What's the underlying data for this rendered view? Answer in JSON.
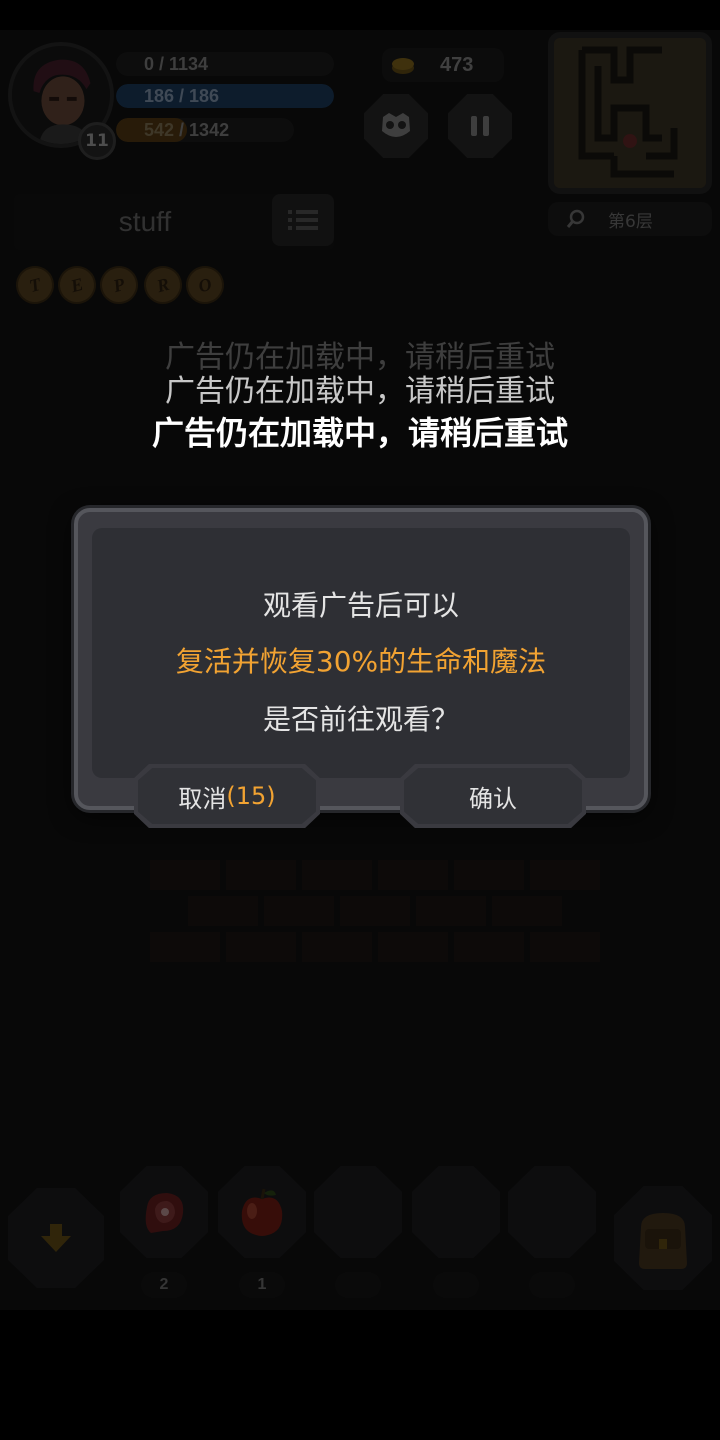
{
  "hud": {
    "level": "11",
    "xp": "0 / 1134",
    "hp": "186 / 186",
    "mp_current": "542",
    "mp_total": " / 1342",
    "hp_fraction": 1.0,
    "mp_fraction": 0.4,
    "gold": "473",
    "floor": "第6层"
  },
  "stuff_label": "stuff",
  "runes": [
    "T",
    "E",
    "P",
    "R",
    "O"
  ],
  "toasts": [
    "广告仍在加载中，请稍后重试",
    "广告仍在加载中，请稍后重试",
    "广告仍在加载中，请稍后重试"
  ],
  "dialog": {
    "line1": "观看广告后可以",
    "line2": "复活并恢复30%的生命和魔法",
    "line3": "是否前往观看？",
    "cancel_label": "取消",
    "cancel_count": "(15)",
    "confirm_label": "确认"
  },
  "hotbar": {
    "slots": [
      {
        "item": "meat-icon",
        "count": "2"
      },
      {
        "item": "apple-icon",
        "count": "1"
      },
      {
        "item": "empty",
        "count": ""
      },
      {
        "item": "empty",
        "count": ""
      },
      {
        "item": "empty",
        "count": ""
      }
    ]
  },
  "colors": {
    "highlight": "#f2a332",
    "dialog_bg": "#2e2f34",
    "hp_bar": "#1d3f63",
    "mp_bar": "#5a3d14"
  }
}
